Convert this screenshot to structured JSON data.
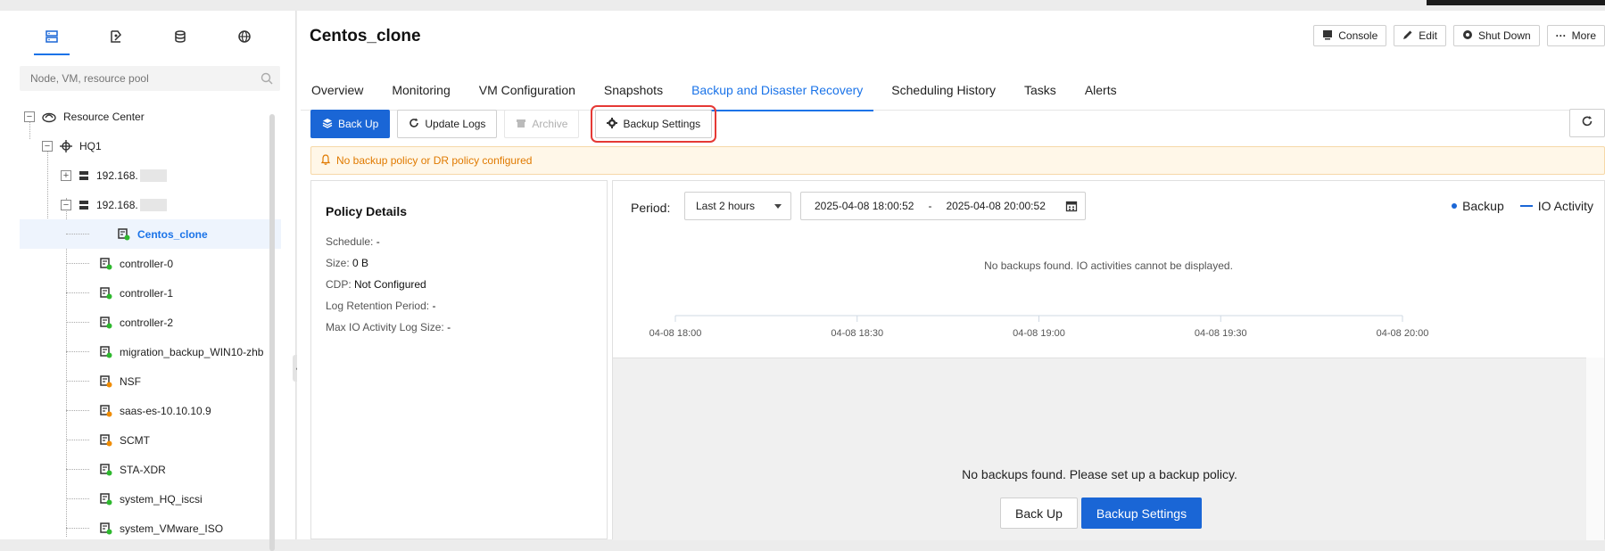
{
  "sidebar": {
    "tabs": [
      "server-icon",
      "edit-shape-icon",
      "storage-icon",
      "network-globe-icon"
    ],
    "search_placeholder": "Node, VM, resource pool",
    "tree": {
      "root": "Resource Center",
      "cluster": "HQ1",
      "node1": "192.168.",
      "node2": "192.168.",
      "vms": [
        {
          "label": "Centos_clone",
          "status": "green"
        },
        {
          "label": "controller-0",
          "status": "green"
        },
        {
          "label": "controller-1",
          "status": "green"
        },
        {
          "label": "controller-2",
          "status": "green"
        },
        {
          "label": "migration_backup_WIN10-zhb",
          "status": "green"
        },
        {
          "label": "NSF",
          "status": "orange"
        },
        {
          "label": "saas-es-10.10.10.9",
          "status": "orange"
        },
        {
          "label": "SCMT",
          "status": "orange"
        },
        {
          "label": "STA-XDR",
          "status": "green"
        },
        {
          "label": "system_HQ_iscsi",
          "status": "green"
        },
        {
          "label": "system_VMware_ISO",
          "status": "green"
        }
      ]
    }
  },
  "header": {
    "title": "Centos_clone",
    "actions": {
      "console": "Console",
      "edit": "Edit",
      "shutdown": "Shut Down",
      "more": "More"
    }
  },
  "tabs": [
    "Overview",
    "Monitoring",
    "VM Configuration",
    "Snapshots",
    "Backup and Disaster Recovery",
    "Scheduling History",
    "Tasks",
    "Alerts"
  ],
  "active_tab": "Backup and Disaster Recovery",
  "toolbar": {
    "backup": "Back Up",
    "update_logs": "Update Logs",
    "archive": "Archive",
    "backup_settings": "Backup Settings"
  },
  "alert": "No backup policy or DR policy configured",
  "policy": {
    "title": "Policy Details",
    "rows": [
      {
        "label": "Schedule:",
        "value": "-"
      },
      {
        "label": "Size:",
        "value": "0 B"
      },
      {
        "label": "CDP:",
        "value": "Not Configured"
      },
      {
        "label": "Log Retention Period:",
        "value": "-"
      },
      {
        "label": "Max IO Activity Log Size:",
        "value": "-"
      }
    ]
  },
  "chart": {
    "period_label": "Period:",
    "period_value": "Last 2 hours",
    "start": "2025-04-08 18:00:52",
    "sep": "-",
    "end": "2025-04-08 20:00:52",
    "legend_backup": "Backup",
    "legend_io": "IO Activity",
    "no_data": "No backups found. IO activities cannot be displayed.",
    "ticks": [
      "04-08 18:00",
      "04-08 18:30",
      "04-08 19:00",
      "04-08 19:30",
      "04-08 20:00"
    ],
    "empty_msg": "No backups found. Please set up a backup policy.",
    "empty_backup_btn": "Back Up",
    "empty_settings_btn": "Backup Settings"
  },
  "colors": {
    "accent": "#1a66d6",
    "alert_text": "#e07a00",
    "highlight": "#e53935",
    "status_green": "#2eb82e",
    "status_orange": "#f08c00"
  }
}
